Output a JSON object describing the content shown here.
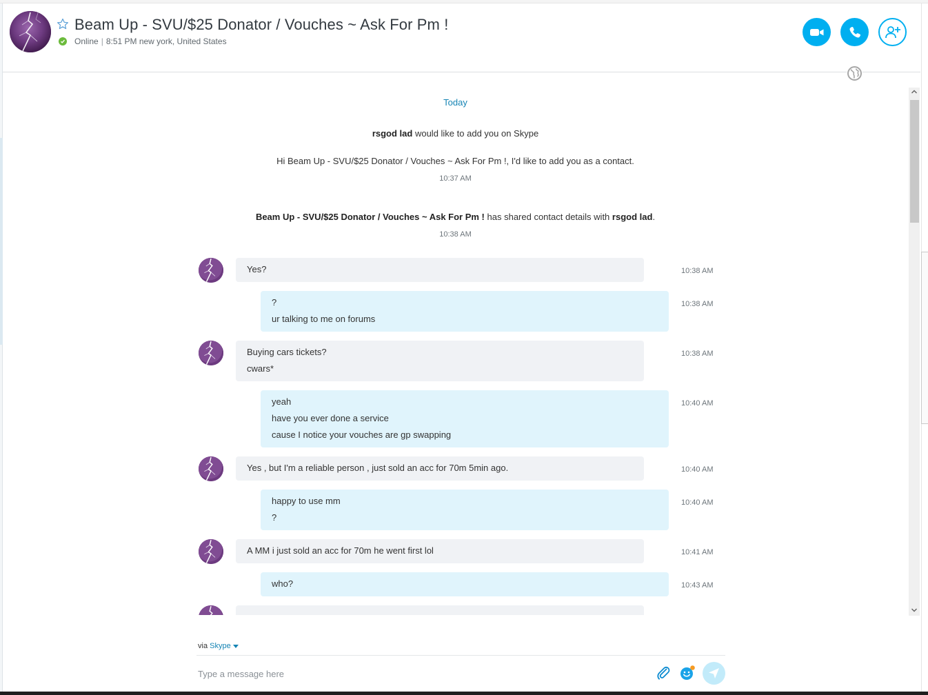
{
  "contact": {
    "name": "Beam Up - SVU/$25 Donator / Vouches ~ Ask For Pm !",
    "status": "Online",
    "local_time": "8:51 PM new york, United States"
  },
  "header_buttons": {
    "video_call": "video-call",
    "audio_call": "call",
    "add_people": "add-people"
  },
  "conversation": {
    "date_separator": "Today",
    "contact_request": {
      "requester": "rsgod lad",
      "text": "would like to add you on Skype",
      "message": "Hi Beam Up - SVU/$25 Donator / Vouches ~ Ask For Pm !, I'd like to add you as a contact.",
      "time": "10:37 AM"
    },
    "shared_contact": {
      "sharer": "Beam Up - SVU/$25 Donator / Vouches ~ Ask For Pm !",
      "middle": "has shared contact details with",
      "recipient": "rsgod lad",
      "end": ".",
      "time": "10:38 AM"
    },
    "messages": [
      {
        "from": "them",
        "lines": [
          "Yes?"
        ],
        "time": "10:38 AM"
      },
      {
        "from": "me",
        "lines": [
          "?",
          "ur talking to me on forums"
        ],
        "time": "10:38 AM"
      },
      {
        "from": "them",
        "lines": [
          "Buying cars tickets?",
          "cwars*"
        ],
        "time": "10:38 AM"
      },
      {
        "from": "me",
        "lines": [
          "yeah",
          "have you ever done a service",
          "cause I notice your vouches are gp swapping"
        ],
        "time": "10:40 AM"
      },
      {
        "from": "them",
        "lines": [
          "Yes , but I'm a reliable person , just sold an acc for 70m 5min ago."
        ],
        "time": "10:40 AM"
      },
      {
        "from": "me",
        "lines": [
          "happy to use mm",
          "?"
        ],
        "time": "10:40 AM"
      },
      {
        "from": "them",
        "lines": [
          "A MM i just sold an acc for 70m he went first lol"
        ],
        "time": "10:41 AM"
      },
      {
        "from": "me",
        "lines": [
          "who?"
        ],
        "time": "10:43 AM"
      }
    ]
  },
  "compose": {
    "via_label": "via",
    "via_service": "Skype",
    "placeholder": "Type a message here"
  },
  "colors": {
    "accent": "#00aff0",
    "link": "#1584b4",
    "incoming_bubble": "#f0f2f5",
    "outgoing_bubble": "#e0f4fc",
    "online": "#6cbb3c",
    "avatar": "#5d2d6d"
  }
}
